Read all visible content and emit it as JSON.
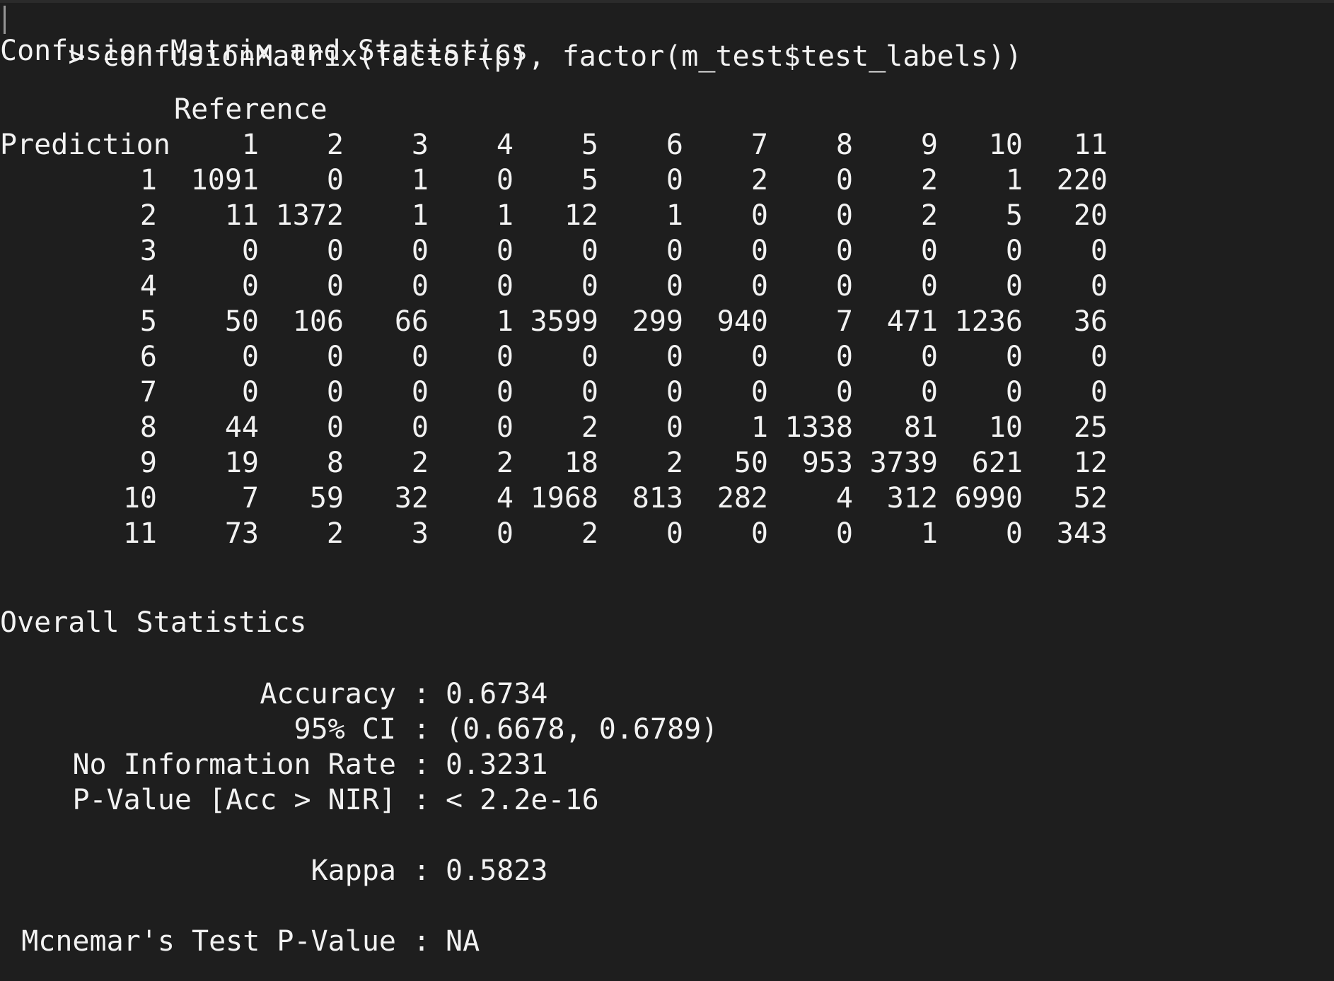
{
  "terminal": {
    "prompt_symbol": ">",
    "command": " confusionMatrix(factor(p), factor(m_test$test_labels))",
    "heading": "Confusion Matrix and Statistics",
    "reference_label": "Reference",
    "prediction_label": "Prediction",
    "column_headers": [
      "1",
      "2",
      "3",
      "4",
      "5",
      "6",
      "7",
      "8",
      "9",
      "10",
      "11"
    ],
    "rows": [
      {
        "label": "1",
        "values": [
          "1091",
          "0",
          "1",
          "0",
          "5",
          "0",
          "2",
          "0",
          "2",
          "1",
          "220"
        ]
      },
      {
        "label": "2",
        "values": [
          "11",
          "1372",
          "1",
          "1",
          "12",
          "1",
          "0",
          "0",
          "2",
          "5",
          "20"
        ]
      },
      {
        "label": "3",
        "values": [
          "0",
          "0",
          "0",
          "0",
          "0",
          "0",
          "0",
          "0",
          "0",
          "0",
          "0"
        ]
      },
      {
        "label": "4",
        "values": [
          "0",
          "0",
          "0",
          "0",
          "0",
          "0",
          "0",
          "0",
          "0",
          "0",
          "0"
        ]
      },
      {
        "label": "5",
        "values": [
          "50",
          "106",
          "66",
          "1",
          "3599",
          "299",
          "940",
          "7",
          "471",
          "1236",
          "36"
        ]
      },
      {
        "label": "6",
        "values": [
          "0",
          "0",
          "0",
          "0",
          "0",
          "0",
          "0",
          "0",
          "0",
          "0",
          "0"
        ]
      },
      {
        "label": "7",
        "values": [
          "0",
          "0",
          "0",
          "0",
          "0",
          "0",
          "0",
          "0",
          "0",
          "0",
          "0"
        ]
      },
      {
        "label": "8",
        "values": [
          "44",
          "0",
          "0",
          "0",
          "2",
          "0",
          "1",
          "1338",
          "81",
          "10",
          "25"
        ]
      },
      {
        "label": "9",
        "values": [
          "19",
          "8",
          "2",
          "2",
          "18",
          "2",
          "50",
          "953",
          "3739",
          "621",
          "12"
        ]
      },
      {
        "label": "10",
        "values": [
          "7",
          "59",
          "32",
          "4",
          "1968",
          "813",
          "282",
          "4",
          "312",
          "6990",
          "52"
        ]
      },
      {
        "label": "11",
        "values": [
          "73",
          "2",
          "3",
          "0",
          "2",
          "0",
          "0",
          "0",
          "1",
          "0",
          "343"
        ]
      }
    ],
    "overall_heading": "Overall Statistics",
    "stats": {
      "accuracy": {
        "label": "Accuracy",
        "value": "0.6734"
      },
      "ci": {
        "label": "95% CI",
        "value": "(0.6678, 0.6789)"
      },
      "nir": {
        "label": "No Information Rate",
        "value": "0.3231"
      },
      "pvalue": {
        "label": "P-Value [Acc > NIR]",
        "value": "< 2.2e-16"
      },
      "kappa": {
        "label": "Kappa",
        "value": "0.5823"
      },
      "mcnemar": {
        "label": "Mcnemar's Test P-Value",
        "value": "NA"
      }
    },
    "separator": ":"
  }
}
